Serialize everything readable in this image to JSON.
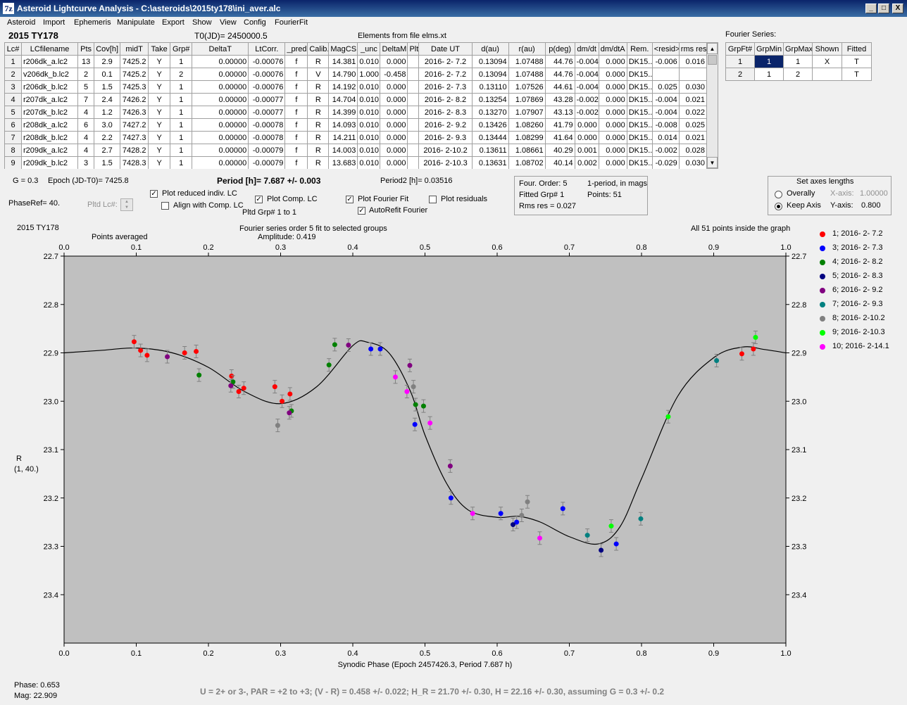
{
  "window": {
    "title": "Asteroid Lightcurve Analysis - C:\\asteroids\\2015ty178\\ini_aver.alc",
    "icon_glyph": "7z",
    "min": "_",
    "max": "□",
    "close": "X"
  },
  "menu": [
    "Asteroid",
    "Import",
    "Ephemeris",
    "Manipulate",
    "Export",
    "Show",
    "View",
    "Config",
    "FourierFit"
  ],
  "header": {
    "object": "2015 TY178",
    "t0": "T0(JD)= 2450000.5",
    "elements": "Elements from file elms.xt"
  },
  "lc_table": {
    "columns": [
      "Lc#",
      "LCfilename",
      "Pts",
      "Cov[h]",
      "midT",
      "Take",
      "Grp#",
      "DeltaT",
      "LtCorr.",
      "_pred.",
      "Calib.",
      "MagCS",
      "_unc",
      "DeltaM",
      "Plt",
      "Date UT",
      "d(au)",
      "r(au)",
      "p(deg)",
      "dm/dt",
      "dm/dtA",
      "Rem.",
      "<resid>",
      "rms res"
    ],
    "rows": [
      [
        "1",
        "r206dk_a.lc2",
        "13",
        "2.9",
        "7425.2",
        "Y",
        "1",
        "0.00000",
        "-0.00076",
        "f",
        "R",
        "14.381",
        "0.010",
        "0.000",
        "",
        "2016- 2- 7.2",
        "0.13094",
        "1.07488",
        "44.76",
        "-0.004",
        "0.000",
        "DK15..",
        "-0.006",
        "0.016"
      ],
      [
        "2",
        "v206dk_b.lc2",
        "2",
        "0.1",
        "7425.2",
        "Y",
        "2",
        "0.00000",
        "-0.00076",
        "f",
        "V",
        "14.790",
        "1.000",
        "-0.458",
        "",
        "2016- 2- 7.2",
        "0.13094",
        "1.07488",
        "44.76",
        "-0.004",
        "0.000",
        "DK15..",
        "",
        ""
      ],
      [
        "3",
        "r206dk_b.lc2",
        "5",
        "1.5",
        "7425.3",
        "Y",
        "1",
        "0.00000",
        "-0.00076",
        "f",
        "R",
        "14.192",
        "0.010",
        "0.000",
        "",
        "2016- 2- 7.3",
        "0.13110",
        "1.07526",
        "44.61",
        "-0.004",
        "0.000",
        "DK15..",
        "0.025",
        "0.030"
      ],
      [
        "4",
        "r207dk_a.lc2",
        "7",
        "2.4",
        "7426.2",
        "Y",
        "1",
        "0.00000",
        "-0.00077",
        "f",
        "R",
        "14.704",
        "0.010",
        "0.000",
        "",
        "2016- 2- 8.2",
        "0.13254",
        "1.07869",
        "43.28",
        "-0.002",
        "0.000",
        "DK15..",
        "-0.004",
        "0.021"
      ],
      [
        "5",
        "r207dk_b.lc2",
        "4",
        "1.2",
        "7426.3",
        "Y",
        "1",
        "0.00000",
        "-0.00077",
        "f",
        "R",
        "14.399",
        "0.010",
        "0.000",
        "",
        "2016- 2- 8.3",
        "0.13270",
        "1.07907",
        "43.13",
        "-0.002",
        "0.000",
        "DK15..",
        "-0.004",
        "0.022"
      ],
      [
        "6",
        "r208dk_a.lc2",
        "6",
        "3.0",
        "7427.2",
        "Y",
        "1",
        "0.00000",
        "-0.00078",
        "f",
        "R",
        "14.093",
        "0.010",
        "0.000",
        "",
        "2016- 2- 9.2",
        "0.13426",
        "1.08260",
        "41.79",
        "0.000",
        "0.000",
        "DK15..",
        "-0.008",
        "0.025"
      ],
      [
        "7",
        "r208dk_b.lc2",
        "4",
        "2.2",
        "7427.3",
        "Y",
        "1",
        "0.00000",
        "-0.00078",
        "f",
        "R",
        "14.211",
        "0.010",
        "0.000",
        "",
        "2016- 2- 9.3",
        "0.13444",
        "1.08299",
        "41.64",
        "0.000",
        "0.000",
        "DK15..",
        "0.014",
        "0.021"
      ],
      [
        "8",
        "r209dk_a.lc2",
        "4",
        "2.7",
        "7428.2",
        "Y",
        "1",
        "0.00000",
        "-0.00079",
        "f",
        "R",
        "14.003",
        "0.010",
        "0.000",
        "",
        "2016- 2-10.2",
        "0.13611",
        "1.08661",
        "40.29",
        "0.001",
        "0.000",
        "DK15..",
        "-0.002",
        "0.028"
      ],
      [
        "9",
        "r209dk_b.lc2",
        "3",
        "1.5",
        "7428.3",
        "Y",
        "1",
        "0.00000",
        "-0.00079",
        "f",
        "R",
        "13.683",
        "0.010",
        "0.000",
        "",
        "2016- 2-10.3",
        "0.13631",
        "1.08702",
        "40.14",
        "0.002",
        "0.000",
        "DK15..",
        "-0.029",
        "0.030"
      ]
    ]
  },
  "fourier_series": {
    "label": "Fourier Series:",
    "columns": [
      "GrpFt#",
      "GrpMin",
      "GrpMax",
      "Shown",
      "Fitted"
    ],
    "rows": [
      [
        "1",
        "1",
        "1",
        "X",
        "T"
      ],
      [
        "2",
        "1",
        "2",
        "",
        "T"
      ]
    ]
  },
  "info": {
    "g": "G = 0.3",
    "epoch": "Epoch (JD-T0)= 7425.8",
    "period": "Period [h]= 7.687 +/- 0.003",
    "period2": "Period2 [h]= 0.03516",
    "phaseref": "PhaseRef= 40.",
    "pltd_lc": "Pltd Lc#:",
    "pltd_grp": "Pltd Grp#   1   to    1"
  },
  "options": {
    "plot_reduced": "Plot reduced indiv. LC",
    "align": "Align with Comp. LC",
    "plot_comp": "Plot Comp. LC",
    "plot_fourier": "Plot Fourier Fit",
    "autorefit": "AutoRefit Fourier",
    "plot_residuals": "Plot residuals",
    "check_mark": "✓"
  },
  "fit_info": {
    "order": "Four. Order:  5",
    "period_type": "1-period, in mags",
    "fitted_grp": "Fitted Grp# 1",
    "points": "Points: 51",
    "rms": "Rms res      = 0.027"
  },
  "axes_box": {
    "title": "Set axes lengths",
    "overally": "Overally",
    "keep": "Keep Axis",
    "xaxis_label": "X-axis:",
    "xaxis_val": "1.00000",
    "yaxis_label": "Y-axis:",
    "yaxis_val": "0.800"
  },
  "chart_header": {
    "object": "2015 TY178",
    "avg": "Points averaged",
    "fit_title": "Fourier series order 5 fit to selected groups",
    "amplitude": "Amplitude: 0.419",
    "inside": "All 51 points inside the graph",
    "y_label_1": "R",
    "y_label_2": "(1, 40.)"
  },
  "chart_data": {
    "type": "scatter",
    "xlabel": "Synodic Phase (Epoch 2457426.3, Period 7.687 h)",
    "xlim": [
      0,
      1
    ],
    "ylim": [
      22.7,
      23.5
    ],
    "y_inverted": true,
    "x_ticks": [
      0.0,
      0.1,
      0.2,
      0.3,
      0.4,
      0.5,
      0.6,
      0.7,
      0.8,
      0.9,
      1.0
    ],
    "y_ticks": [
      22.7,
      22.8,
      22.9,
      23.0,
      23.1,
      23.2,
      23.3,
      23.4
    ],
    "legend_position": "right",
    "fit_curve": {
      "x": [
        0,
        0.05,
        0.1,
        0.15,
        0.2,
        0.25,
        0.3,
        0.35,
        0.4,
        0.42,
        0.45,
        0.48,
        0.5,
        0.53,
        0.56,
        0.6,
        0.63,
        0.66,
        0.7,
        0.74,
        0.77,
        0.8,
        0.85,
        0.9,
        0.94,
        0.97,
        1.0
      ],
      "y": [
        22.9,
        22.895,
        22.89,
        22.9,
        22.93,
        22.98,
        23.005,
        22.97,
        22.885,
        22.878,
        22.9,
        22.98,
        23.07,
        23.17,
        23.225,
        23.24,
        23.238,
        23.25,
        23.28,
        23.295,
        23.26,
        23.16,
        22.99,
        22.91,
        22.888,
        22.893,
        22.9
      ]
    },
    "series": [
      {
        "name": "1; 2016- 2- 7.2",
        "color": "#ff0000",
        "points": [
          [
            0.097,
            22.877
          ],
          [
            0.106,
            22.895
          ],
          [
            0.115,
            22.905
          ],
          [
            0.167,
            22.9
          ],
          [
            0.183,
            22.897
          ],
          [
            0.232,
            22.948
          ],
          [
            0.242,
            22.98
          ],
          [
            0.249,
            22.973
          ],
          [
            0.292,
            22.97
          ],
          [
            0.302,
            23.0
          ],
          [
            0.313,
            22.985
          ],
          [
            0.939,
            22.902
          ],
          [
            0.955,
            22.892
          ]
        ]
      },
      {
        "name": "3; 2016- 2- 7.3",
        "color": "#0000ff",
        "points": [
          [
            0.425,
            22.892
          ],
          [
            0.438,
            22.892
          ],
          [
            0.486,
            23.048
          ],
          [
            0.536,
            23.2
          ],
          [
            0.605,
            23.232
          ],
          [
            0.627,
            23.25
          ],
          [
            0.691,
            23.222
          ],
          [
            0.765,
            23.295
          ]
        ]
      },
      {
        "name": "4; 2016- 2- 8.2",
        "color": "#008000",
        "points": [
          [
            0.187,
            22.946
          ],
          [
            0.234,
            22.96
          ],
          [
            0.315,
            23.02
          ],
          [
            0.367,
            22.925
          ],
          [
            0.375,
            22.883
          ],
          [
            0.487,
            23.007
          ],
          [
            0.498,
            23.01
          ]
        ]
      },
      {
        "name": "5; 2016- 2- 8.3",
        "color": "#000080",
        "points": [
          [
            0.622,
            23.255
          ],
          [
            0.744,
            23.308
          ]
        ]
      },
      {
        "name": "6; 2016- 2- 9.2",
        "color": "#800080",
        "points": [
          [
            0.143,
            22.908
          ],
          [
            0.231,
            22.968
          ],
          [
            0.312,
            23.024
          ],
          [
            0.394,
            22.884
          ],
          [
            0.479,
            22.926
          ],
          [
            0.535,
            23.134
          ]
        ]
      },
      {
        "name": "7; 2016- 2- 9.3",
        "color": "#008080",
        "points": [
          [
            0.725,
            23.277
          ],
          [
            0.799,
            23.243
          ],
          [
            0.904,
            22.916
          ]
        ]
      },
      {
        "name": "8; 2016- 2-10.2",
        "color": "#808080",
        "points": [
          [
            0.296,
            23.05
          ],
          [
            0.484,
            22.97
          ],
          [
            0.634,
            23.236
          ],
          [
            0.642,
            23.208
          ]
        ]
      },
      {
        "name": "9; 2016- 2-10.3",
        "color": "#00ff00",
        "points": [
          [
            0.758,
            23.258
          ],
          [
            0.837,
            23.032
          ],
          [
            0.958,
            22.868
          ]
        ]
      },
      {
        "name": "10; 2016- 2-14.1",
        "color": "#ff00ff",
        "points": [
          [
            0.459,
            22.95
          ],
          [
            0.475,
            22.98
          ],
          [
            0.507,
            23.045
          ],
          [
            0.566,
            23.232
          ],
          [
            0.659,
            23.283
          ]
        ]
      }
    ]
  },
  "status": {
    "phase": "Phase:  0.653",
    "mag": "Mag:     22.909",
    "footer": "U = 2+ or 3-, PAR = +2 to +3; (V - R) = 0.458 +/- 0.022; H_R = 21.70 +/- 0.30, H = 22.16 +/- 0.30, assuming G = 0.3 +/- 0.2"
  }
}
